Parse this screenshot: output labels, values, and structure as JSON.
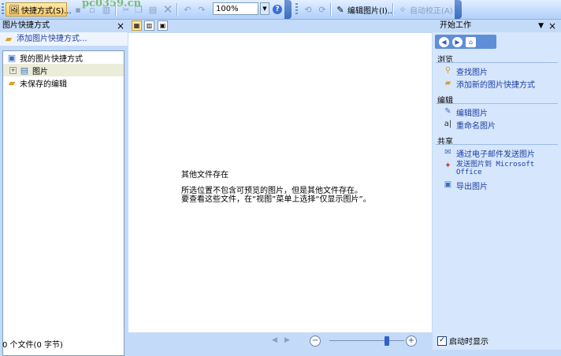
{
  "toolbar": {
    "shortcuts_label": "快捷方式(S)...",
    "zoom_value": "100%",
    "edit_picture_label": "编辑图片(I)...",
    "auto_correct_label": "自动校正(A)",
    "watermark": "pc0359.cn"
  },
  "left_pane": {
    "title": "图片快捷方式",
    "add_shortcut": "添加图片快捷方式...",
    "tree": [
      {
        "label": "我的图片快捷方式"
      },
      {
        "label": "图片"
      },
      {
        "label": "未保存的编辑"
      }
    ],
    "status": "0 个文件(0 字节)"
  },
  "main": {
    "message_title": "其他文件存在",
    "message_line1": "所选位置不包含可预览的图片，但是其他文件存在。",
    "message_line2": "要查看这些文件，在“视图”菜单上选择“仅显示图片”。"
  },
  "right_pane": {
    "title": "开始工作",
    "sections": [
      {
        "heading": "浏览",
        "links": [
          "查找图片",
          "添加新的图片快捷方式"
        ]
      },
      {
        "heading": "编辑",
        "links": [
          "编辑图片",
          "重命名图片"
        ]
      },
      {
        "heading": "共享",
        "links": [
          "通过电子邮件发送图片",
          "发送图片到 Microsoft Office",
          "导出图片"
        ]
      }
    ],
    "show_at_startup": "启动时显示"
  },
  "colors": {
    "accent": "#3d6dbd",
    "link": "#1c3fa0",
    "pane_bg": "#c3daf9"
  }
}
